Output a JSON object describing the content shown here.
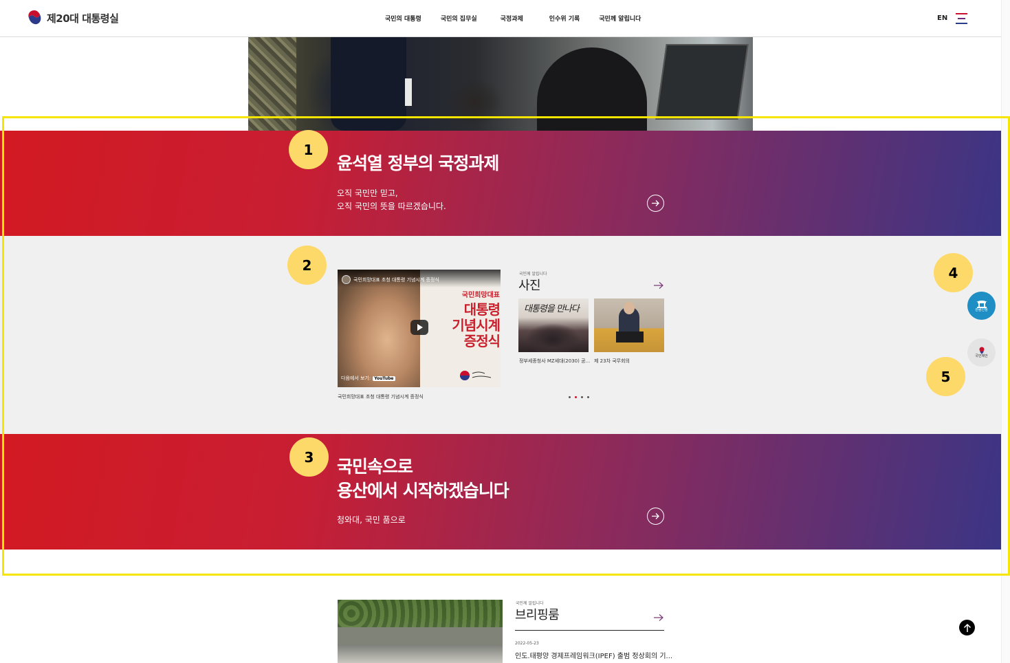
{
  "header": {
    "logo_text": "제20대 대통령실",
    "nav": [
      "국민의 대통령",
      "국민의 집무실",
      "국정과제",
      "인수위 기록",
      "국민께 알립니다"
    ],
    "lang": "EN"
  },
  "banner1": {
    "title": "윤석열 정부의 국정과제",
    "subtitle": "오직 국민만 믿고,\n오직 국민의 뜻을 따르겠습니다."
  },
  "video": {
    "caption": "국민희망대표 초청 대통령 기념시계 증정식",
    "overlay_small": "국민희망대표",
    "overlay_line1": "대통령",
    "overlay_line2": "기념시계",
    "overlay_line3": "증정식",
    "watch_on": "다음에서 보기:",
    "youtube": "YouTube",
    "label": "국민희망대표 초청 대통령 기념시계 증정식"
  },
  "photos": {
    "kicker": "국민께 알립니다",
    "heading": "사진",
    "thumb1_overlay": "대통령을 만나다",
    "items": [
      {
        "caption": "정부세종청사 MZ세대(2030) 공..."
      },
      {
        "caption": "제 23차 국무회의"
      }
    ]
  },
  "banner3": {
    "title": "국민속으로\n용산에서 시작하겠습니다",
    "subtitle": "청와대, 국민 품으로"
  },
  "float_buttons": {
    "cheongwadae": "관람신청",
    "people_proposal": "국민제안"
  },
  "badges": [
    "1",
    "2",
    "3",
    "4",
    "5"
  ],
  "briefing": {
    "kicker": "국민께 알립니다",
    "heading": "브리핑룸",
    "date": "2022-05-23",
    "headline": "인도.태평양 경제프레임워크(IPEF) 출범 정상회의 기..."
  },
  "colors": {
    "brand_red": "#c8102e",
    "brand_navy": "#2c3a8a",
    "highlight": "#f5e500",
    "badge": "#fdd96a"
  }
}
